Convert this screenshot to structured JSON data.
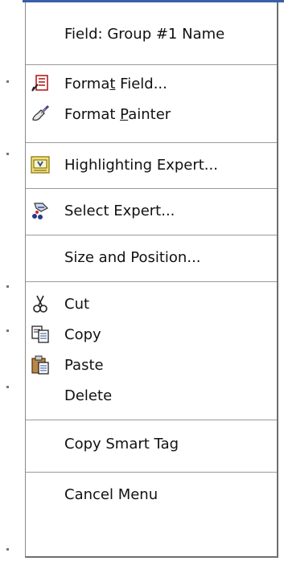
{
  "menu": {
    "header": "Field: Group #1 Name",
    "format_field": "Format Field...",
    "format_field_underline": "t",
    "format_painter": "Format Painter",
    "format_painter_underline": "P",
    "highlighting_expert": "Highlighting Expert...",
    "select_expert": "Select Expert...",
    "size_position": "Size and Position...",
    "cut": "Cut",
    "copy": "Copy",
    "paste": "Paste",
    "delete": "Delete",
    "copy_smart_tag": "Copy Smart Tag",
    "cancel_menu": "Cancel Menu"
  },
  "icons": {
    "format_field": "format-field-icon",
    "format_painter": "paintbrush-icon",
    "highlighting_expert": "highlighting-expert-icon",
    "select_expert": "select-expert-icon",
    "cut": "scissors-icon",
    "copy": "copy-icon",
    "paste": "paste-icon"
  },
  "colors": {
    "accent_blue": "#3a5ea8",
    "menu_bg": "#ffffff",
    "border": "#6e6e6e"
  }
}
